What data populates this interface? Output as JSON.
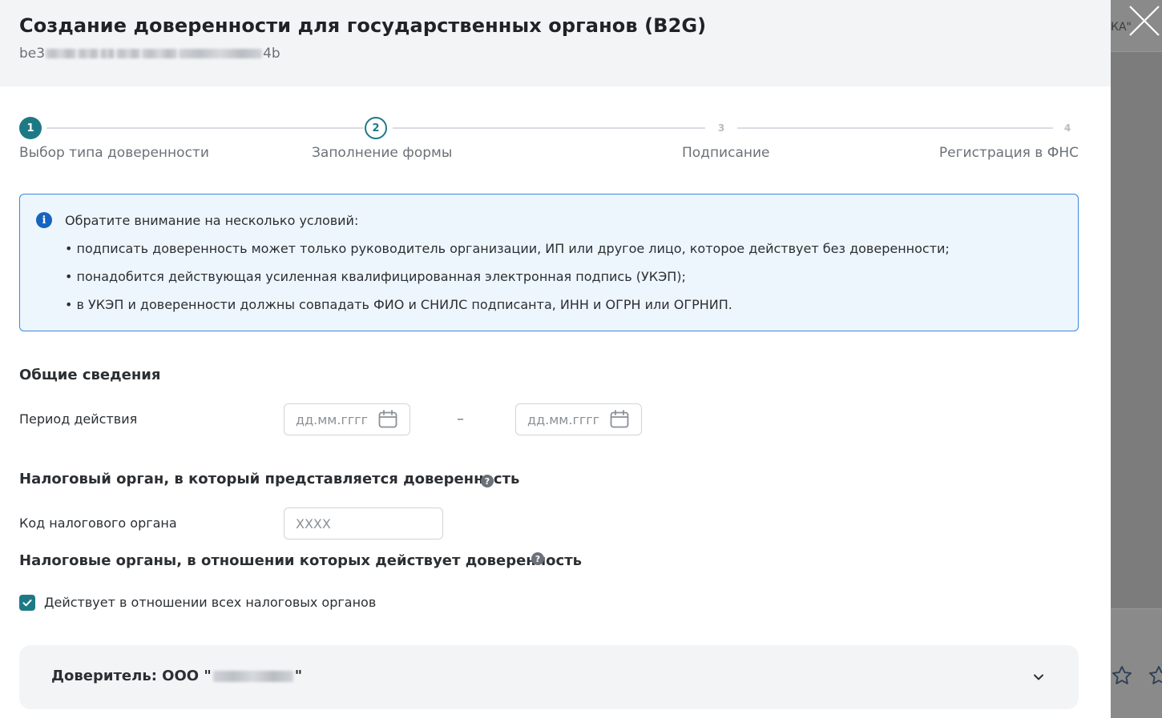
{
  "modal": {
    "title": "Создание доверенности для государственных органов (B2G)",
    "id_prefix": "be3",
    "id_suffix": "4b"
  },
  "stepper": {
    "steps": [
      {
        "number": "1",
        "label": "Выбор типа доверенности",
        "state": "done"
      },
      {
        "number": "2",
        "label": "Заполнение формы",
        "state": "active"
      },
      {
        "number": "3",
        "label": "Подписание",
        "state": "todo"
      },
      {
        "number": "4",
        "label": "Регистрация в ФНС",
        "state": "todo"
      }
    ]
  },
  "info": {
    "heading": "Обратите внимание на несколько условий:",
    "items": [
      "• подписать доверенность может только руководитель организации, ИП или другое лицо, которое действует без доверенности;",
      "• понадобится действующая усиленная квалифицированная электронная подпись (УКЭП);",
      "• в УКЭП и доверенности должны совпадать ФИО и СНИЛС подписанта, ИНН и ОГРН или ОГРНИП."
    ]
  },
  "general": {
    "title": "Общие сведения",
    "period_label": "Период действия",
    "date_from_placeholder": "дд.мм.гггг",
    "date_to_placeholder": "дд.мм.гггг",
    "separator": "–"
  },
  "tax_authority": {
    "title": "Налоговый орган, в который представляется доверенность",
    "code_label": "Код налогового органа",
    "code_placeholder": "XXXX"
  },
  "tax_authorities_scope": {
    "title": "Налоговые органы, в отношении которых действует доверенность",
    "all_checkbox_label": "Действует в отношении всех налоговых органов",
    "all_checked": true
  },
  "principal": {
    "prefix": "Доверитель: ООО \"",
    "suffix": "\""
  },
  "background": {
    "fragment": "КА\""
  },
  "colors": {
    "accent": "#1d7a85",
    "info_border": "#3b87d8",
    "info_bg": "#eef6fd",
    "info_icon": "#1565c0"
  }
}
